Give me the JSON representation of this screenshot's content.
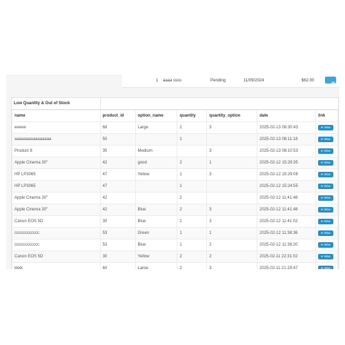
{
  "order": {
    "number": "1",
    "customer": "aaaa ssss",
    "status": "Pending",
    "date": "11/09/2024",
    "total": "$62.00",
    "view_icon": "eye-icon"
  },
  "panel": {
    "title": "Low Quantity & Out of Stock"
  },
  "table": {
    "columns": [
      "name",
      "product_id",
      "option_name",
      "quantity",
      "quantity_option",
      "date",
      "link"
    ],
    "view_label": "View",
    "rows": [
      {
        "name": "eeeee",
        "product_id": "68",
        "option_name": "Large",
        "quantity": "2",
        "quantity_option": "3",
        "date": "2025-02-13 08:30:43"
      },
      {
        "name": "aaaaaaaaaaaaaaaa",
        "product_id": "50",
        "option_name": "",
        "quantity": "1",
        "quantity_option": "",
        "date": "2025-02-13 08:11:18"
      },
      {
        "name": "Product 8",
        "product_id": "35",
        "option_name": "Medium",
        "quantity": "",
        "quantity_option": "3",
        "date": "2025-02-13 08:10:53"
      },
      {
        "name": "Apple Cinema 30\"",
        "product_id": "42",
        "option_name": "good",
        "quantity": "2",
        "quantity_option": "1",
        "date": "2025-02-12 15:29:35"
      },
      {
        "name": "HP LP3065",
        "product_id": "47",
        "option_name": "Yellow",
        "quantity": "1",
        "quantity_option": "3",
        "date": "2025-02-12 15:29:08"
      },
      {
        "name": "HP LP3065",
        "product_id": "47",
        "option_name": "",
        "quantity": "1",
        "quantity_option": "",
        "date": "2025-02-12 15:24:55"
      },
      {
        "name": "Apple Cinema 30\"",
        "product_id": "42",
        "option_name": "",
        "quantity": "2",
        "quantity_option": "",
        "date": "2025-02-12 11:41:48"
      },
      {
        "name": "Apple Cinema 30\"",
        "product_id": "42",
        "option_name": "Blue",
        "quantity": "2",
        "quantity_option": "3",
        "date": "2025-02-12 11:41:48"
      },
      {
        "name": "Canon EOS 5D",
        "product_id": "30",
        "option_name": "Blue",
        "quantity": "2",
        "quantity_option": "3",
        "date": "2025-02-12 11:41:02"
      },
      {
        "name": "cccccccccccc",
        "product_id": "53",
        "option_name": "Green",
        "quantity": "1",
        "quantity_option": "1",
        "date": "2025-02-12 11:38:36"
      },
      {
        "name": "cccccccccccc",
        "product_id": "53",
        "option_name": "Blue",
        "quantity": "1",
        "quantity_option": "2",
        "date": "2025-02-12 11:38:20"
      },
      {
        "name": "Canon EOS 5D",
        "product_id": "30",
        "option_name": "Yellow",
        "quantity": "2",
        "quantity_option": "2",
        "date": "2025-02-11 22:31:02"
      },
      {
        "name": "kkkk",
        "product_id": "60",
        "option_name": "Large",
        "quantity": "2",
        "quantity_option": "3",
        "date": "2025-02-11 21:29:47"
      }
    ]
  },
  "colors": {
    "accent": "#1e91cf",
    "background": "#f5f5f5"
  }
}
